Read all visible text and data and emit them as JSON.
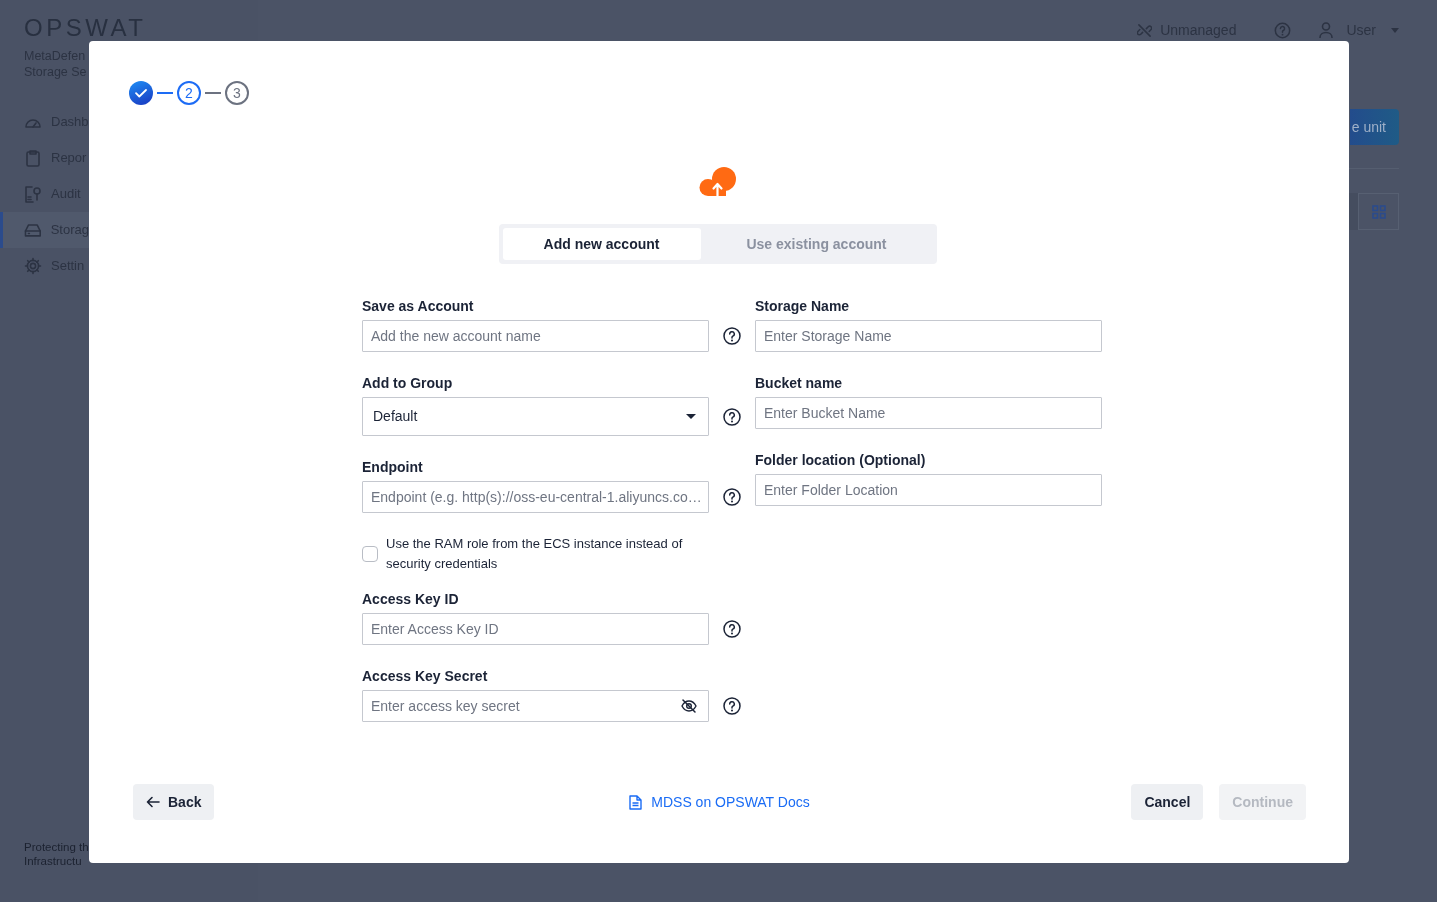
{
  "background": {
    "logo": "OPSWAT",
    "product_name_lines": [
      "MetaDefen",
      "Storage Se"
    ],
    "sidebar": {
      "items": [
        {
          "label": "Dashb",
          "selected": false
        },
        {
          "label": "Repor",
          "selected": false
        },
        {
          "label": "Audit",
          "selected": false
        },
        {
          "label": "Storag",
          "selected": true
        },
        {
          "label": "Settin",
          "selected": false
        }
      ],
      "footer_lines": [
        "Protecting th",
        "Infrastructu"
      ]
    },
    "header": {
      "status": "Unmanaged",
      "user": "User"
    },
    "toolbar": {
      "primary_button": "e unit"
    }
  },
  "dialog": {
    "steps": [
      {
        "done": true,
        "selected": false
      },
      {
        "label": "2",
        "done": false,
        "selected": true
      },
      {
        "label": "3",
        "done": false,
        "selected": false
      }
    ],
    "tabs": [
      {
        "label": "Add new account",
        "selected": true
      },
      {
        "label": "Use existing account",
        "selected": false
      }
    ],
    "form": {
      "left": [
        {
          "kind": "text",
          "label": "Save as Account",
          "placeholder": "Add the new account name",
          "help": true
        },
        {
          "kind": "select",
          "label": "Add to Group",
          "value": "Default",
          "help": true
        },
        {
          "kind": "text",
          "label": "Endpoint",
          "placeholder": "Endpoint (e.g. http(s)://oss-eu-central-1.aliyuncs.co…",
          "help": true
        },
        {
          "kind": "checkbox",
          "label": "Use the RAM role from the ECS instance instead of security credentials",
          "checked": false
        },
        {
          "kind": "text",
          "label": "Access Key ID",
          "placeholder": "Enter Access Key ID",
          "help": true
        },
        {
          "kind": "password",
          "label": "Access Key Secret",
          "placeholder": "Enter access key secret",
          "help": true
        }
      ],
      "right": [
        {
          "kind": "text",
          "label": "Storage Name",
          "placeholder": "Enter Storage Name"
        },
        {
          "kind": "text",
          "label": "Bucket name",
          "placeholder": "Enter Bucket Name"
        },
        {
          "kind": "text",
          "label": "Folder location (Optional)",
          "placeholder": "Enter Folder Location"
        }
      ]
    },
    "footer": {
      "back": "Back",
      "docs_link": "MDSS on OPSWAT Docs",
      "actions": [
        {
          "label": "Cancel",
          "disabled": false
        },
        {
          "label": "Continue",
          "disabled": true
        }
      ]
    }
  }
}
